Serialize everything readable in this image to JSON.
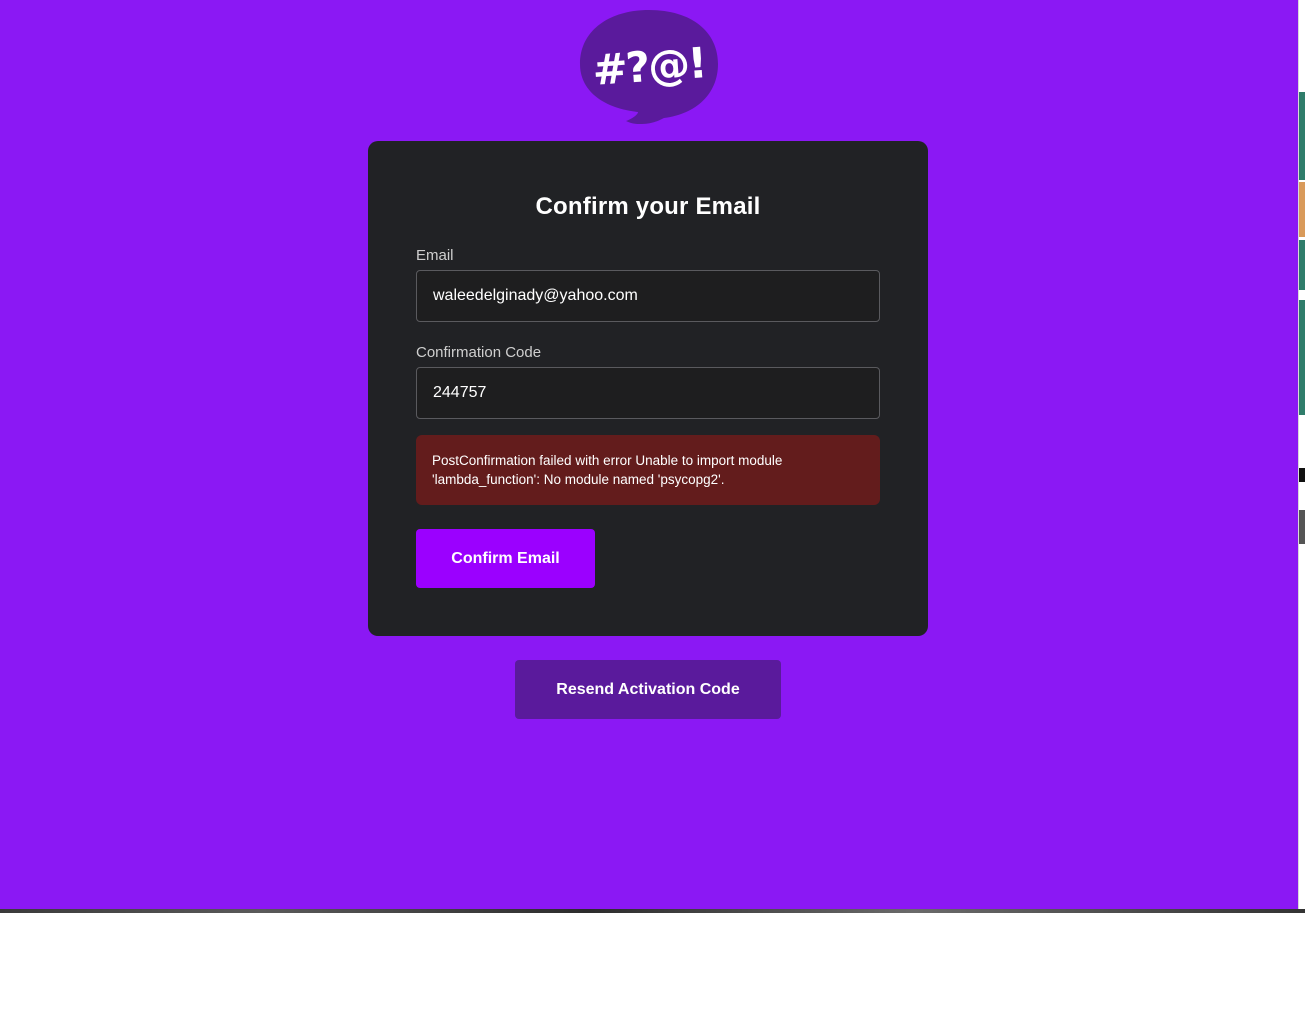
{
  "logo": {
    "text": "#?@!",
    "icon": "speech-bubble-logo-icon",
    "bubble_color": "#5a1a9c"
  },
  "colors": {
    "background": "#8b18f4",
    "card": "#212225",
    "error": "#631c1c",
    "primary_button": "#9b00ff",
    "secondary_button": "#5a1a9c"
  },
  "card": {
    "title": "Confirm your Email",
    "email": {
      "label": "Email",
      "value": "waleedelginady@yahoo.com"
    },
    "code": {
      "label": "Confirmation Code",
      "value": "244757"
    },
    "error": {
      "line1": "PostConfirmation failed with error Unable to import module",
      "line2": "'lambda_function': No module named 'psycopg2'."
    },
    "confirm_button": "Confirm Email"
  },
  "resend_button": "Resend Activation Code"
}
